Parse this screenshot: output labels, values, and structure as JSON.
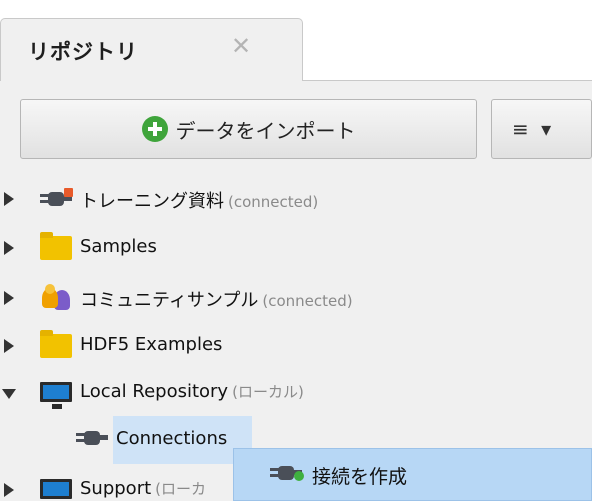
{
  "tab": {
    "title": "リポジトリ",
    "close_glyph": "✕"
  },
  "toolbar": {
    "import_label": "データをインポート",
    "import_icon": "plus-circle-icon",
    "menu_label": "≡ ▾"
  },
  "tree": {
    "items": [
      {
        "label": "トレーニング資料",
        "status": "(connected)",
        "icon": "plug-cloud-icon",
        "expanded": false
      },
      {
        "label": "Samples",
        "status": "",
        "icon": "folder-icon",
        "expanded": false
      },
      {
        "label": "コミュニティサンプル",
        "status": "(connected)",
        "icon": "users-icon",
        "expanded": false
      },
      {
        "label": "HDF5 Examples",
        "status": "",
        "icon": "folder-icon",
        "expanded": false
      },
      {
        "label": "Local Repository",
        "status": "(ローカル)",
        "icon": "monitor-icon",
        "expanded": true
      },
      {
        "label": "Connections",
        "status": "",
        "icon": "plug-icon",
        "selected": true
      },
      {
        "label": "Support",
        "status": "(ローカ",
        "icon": "monitor-icon",
        "expanded": false
      }
    ]
  },
  "context_menu": {
    "item_label": "接続を作成",
    "item_icon": "plug-add-icon"
  },
  "colors": {
    "selection": "#cfe3f7",
    "menu_highlight": "#b7d7f5",
    "panel_bg": "#f0f0f0"
  }
}
